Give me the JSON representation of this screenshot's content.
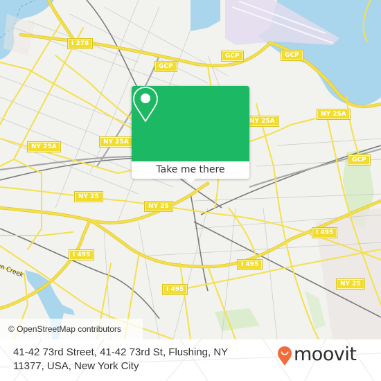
{
  "map": {
    "highway_shields": [
      {
        "label": "I 278",
        "pos": "top-left"
      },
      {
        "label": "GCP",
        "pos": "top-center-left"
      },
      {
        "label": "GCP",
        "pos": "top-center"
      },
      {
        "label": "GCP",
        "pos": "top-right"
      },
      {
        "label": "NY 25A",
        "pos": "left"
      },
      {
        "label": "NY 25A",
        "pos": "center-left"
      },
      {
        "label": "NY 25A",
        "pos": "center-right"
      },
      {
        "label": "NY 25A",
        "pos": "right"
      },
      {
        "label": "GCP",
        "pos": "right"
      },
      {
        "label": "NY 25",
        "pos": "center-left"
      },
      {
        "label": "NY 25",
        "pos": "center"
      },
      {
        "label": "I 495",
        "pos": "lower-left"
      },
      {
        "label": "I 495",
        "pos": "lower-right"
      },
      {
        "label": "I 495",
        "pos": "lower-center"
      },
      {
        "label": "I 495",
        "pos": "right"
      },
      {
        "label": "NY 25",
        "pos": "lower-right"
      }
    ],
    "water_label": "Newtown Creek",
    "water_label_visible": "wn Creek",
    "colors": {
      "land": "#f2f2ef",
      "water": "#a9d6ec",
      "highway": "#f5e04a",
      "rail": "#777777",
      "park": "#d5ebc4",
      "airport": "#e4dcef"
    }
  },
  "popup": {
    "button_label": "Take me there",
    "icon": "map-pin-icon",
    "accent_color": "#1db863"
  },
  "attribution": "© OpenStreetMap contributors",
  "footer": {
    "address": "41-42 73rd Street, 41-42 73rd St, Flushing, NY 11377, USA, New York City",
    "logo_text": "moovit",
    "logo_color": "#f26b3a"
  }
}
